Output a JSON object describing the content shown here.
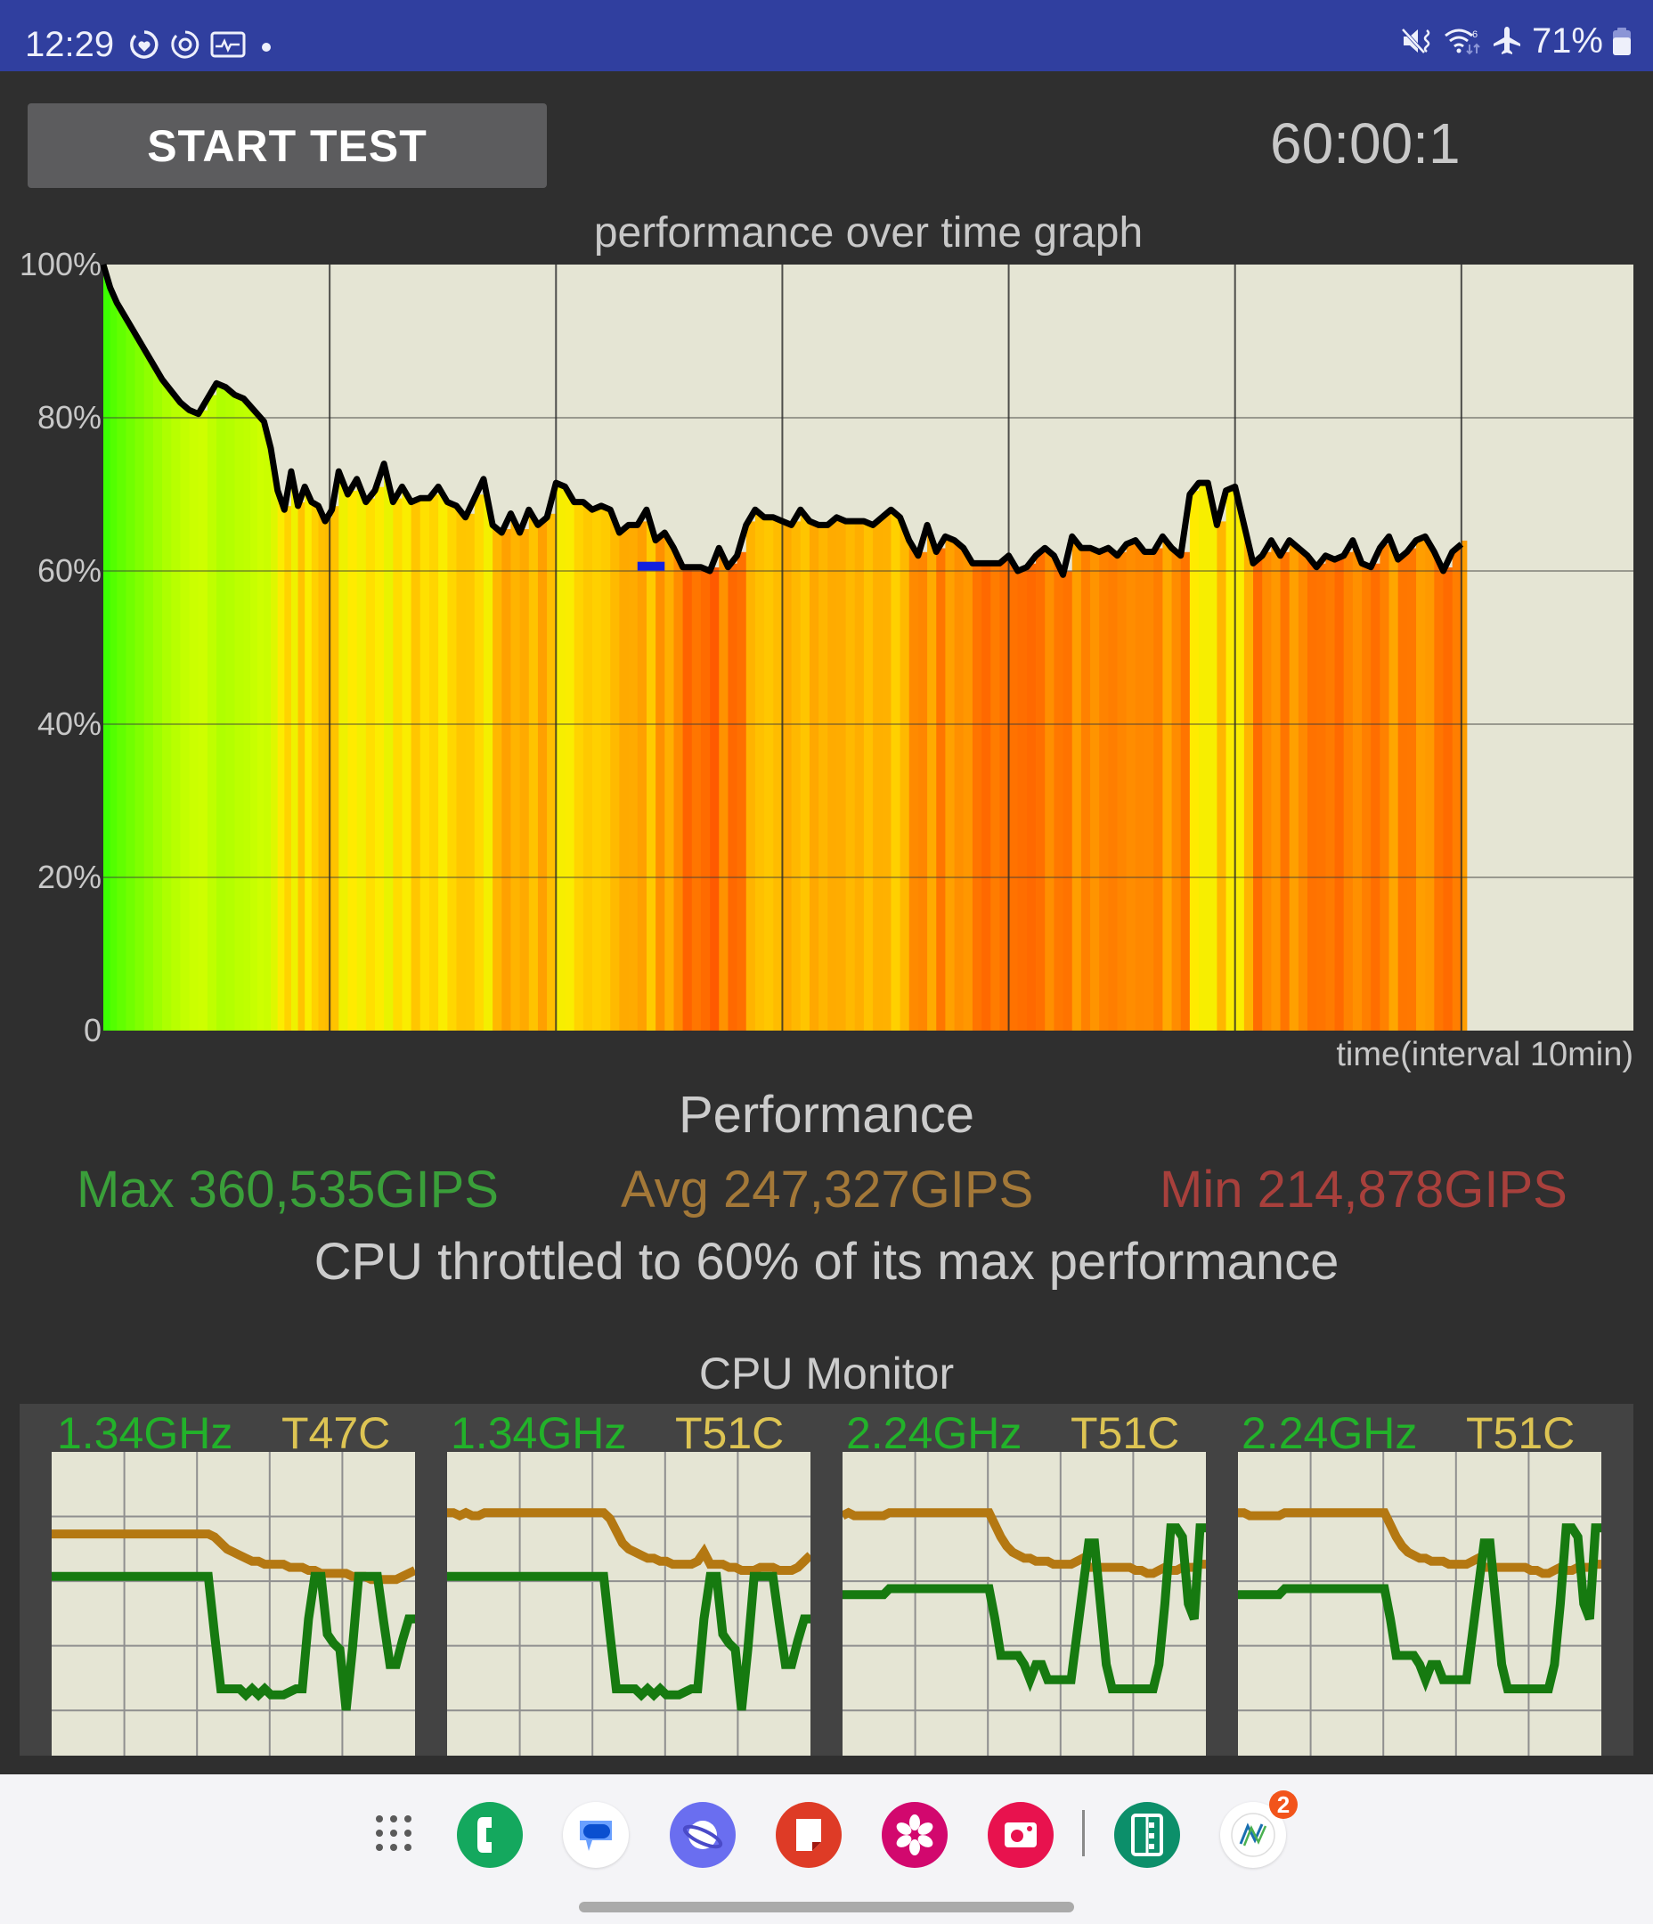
{
  "status_bar": {
    "time": "12:29",
    "left_icons": [
      "health-ring-icon",
      "sync-ring-icon",
      "activity-monitor-icon",
      "notification-dot"
    ],
    "right_icons": [
      "mute-vibrate-icon",
      "wifi-6-icon",
      "airplane-mode-icon"
    ],
    "battery_percent": "71%",
    "battery_level": 0.71
  },
  "header": {
    "start_button_label": "START TEST",
    "timer": "60:00:1"
  },
  "chart_data": {
    "type": "area",
    "title": "performance over time graph",
    "xlabel": "time(interval 10min)",
    "ylabel": "",
    "y_tick_labels": [
      "100%",
      "80%",
      "60%",
      "40%",
      "20%",
      "0"
    ],
    "y_ticks": [
      100,
      80,
      60,
      40,
      20,
      0
    ],
    "ylim": [
      0,
      100
    ],
    "xlim_minutes": [
      0,
      67.6
    ],
    "x_gridlines_minutes": [
      10,
      20,
      30,
      40,
      50,
      60
    ],
    "grid": true,
    "legend": "none",
    "series": [
      {
        "name": "performance",
        "x_minutes": [
          0,
          0.3,
          0.6,
          1.0,
          1.4,
          1.8,
          2.2,
          2.6,
          3.0,
          3.4,
          3.8,
          4.2,
          4.6,
          5.0,
          5.4,
          5.8,
          6.2,
          6.5,
          6.8,
          7.1,
          7.4,
          7.7,
          8.0,
          8.3,
          8.6,
          8.9,
          9.2,
          9.5,
          9.8,
          10.1,
          10.4,
          10.8,
          11.2,
          11.6,
          12.0,
          12.4,
          12.8,
          13.2,
          13.6,
          14.0,
          14.4,
          14.8,
          15.2,
          15.6,
          16.0,
          16.4,
          16.8,
          17.2,
          17.6,
          18.0,
          18.4,
          18.8,
          19.2,
          19.6,
          20.0,
          20.4,
          20.8,
          21.2,
          21.6,
          22.0,
          22.4,
          22.8,
          23.2,
          23.6,
          24.0,
          24.4,
          24.8,
          25.2,
          25.6,
          26.0,
          26.4,
          26.8,
          27.2,
          27.6,
          28.0,
          28.4,
          28.8,
          29.2,
          29.6,
          30.0,
          30.4,
          30.8,
          31.2,
          31.6,
          32.0,
          32.4,
          32.8,
          33.2,
          33.6,
          34.0,
          34.4,
          34.8,
          35.2,
          35.6,
          36.0,
          36.4,
          36.8,
          37.2,
          37.6,
          38.0,
          38.4,
          38.8,
          39.2,
          39.6,
          40.0,
          40.4,
          40.8,
          41.2,
          41.6,
          42.0,
          42.4,
          42.8,
          43.2,
          43.6,
          44.0,
          44.4,
          44.8,
          45.2,
          45.6,
          46.0,
          46.4,
          46.8,
          47.2,
          47.6,
          48.0,
          48.4,
          48.8,
          49.2,
          49.6,
          50.0,
          50.4,
          50.8,
          51.2,
          51.6,
          52.0,
          52.4,
          52.8,
          53.2,
          53.6,
          54.0,
          54.4,
          54.8,
          55.2,
          55.6,
          56.0,
          56.4,
          56.8,
          57.2,
          57.6,
          58.0,
          58.4,
          58.8,
          59.2,
          59.6,
          60.0
        ],
        "values": [
          100,
          97,
          95,
          93,
          91,
          89,
          87,
          85,
          83.5,
          82,
          81,
          80.5,
          82.5,
          84.5,
          84,
          83,
          82.5,
          81.5,
          80.5,
          79.5,
          76,
          70.5,
          68,
          73,
          68.5,
          71,
          69,
          68.5,
          66.5,
          68,
          73,
          70,
          72,
          69,
          70.5,
          74,
          69,
          71,
          69,
          69.5,
          69.5,
          71,
          69,
          68.5,
          67,
          69.5,
          72,
          66,
          65,
          67.5,
          65,
          68,
          66,
          67,
          71.5,
          71,
          69,
          69,
          68,
          68.5,
          68,
          65,
          66,
          66,
          68,
          64,
          65,
          63,
          60.5,
          60.5,
          60.5,
          60,
          63,
          60.5,
          62,
          66,
          68,
          67,
          67,
          66.5,
          66,
          68,
          66.5,
          66,
          66,
          67,
          66.5,
          66.5,
          66.5,
          66,
          67,
          68,
          67,
          64,
          62,
          66,
          62.5,
          64.5,
          64,
          63,
          61,
          61,
          61,
          61,
          62,
          60,
          60.5,
          62,
          63,
          62,
          59.5,
          64.5,
          63,
          63,
          62.5,
          63,
          62,
          63.5,
          64,
          62.5,
          62.5,
          64.5,
          63,
          62,
          70,
          71.5,
          71.5,
          66,
          70.5,
          71,
          66,
          61,
          62,
          64,
          62,
          64,
          63,
          62,
          60.5,
          62,
          61.5,
          62,
          64,
          61,
          60.5,
          63,
          64.5,
          61.5,
          62.5,
          64,
          64.5,
          62.5,
          60,
          62.5,
          63.5,
          62.5,
          62.5,
          64.5,
          59,
          60,
          63,
          62,
          62.5,
          61,
          63,
          64,
          66.5,
          64.5
        ]
      }
    ],
    "min_marker": {
      "x_minutes": [
        23.6,
        24.8
      ],
      "value": 60.5,
      "color": "#1020e0"
    },
    "fill_colorscale": "green (100%) → yellow-green → yellow → orange (~60%) per time slice"
  },
  "summary": {
    "title": "Performance",
    "max": "Max 360,535GIPS",
    "avg": "Avg 247,327GIPS",
    "min": "Min 214,878GIPS",
    "throttle_message": "CPU throttled to 60% of its max performance",
    "colors": {
      "max": "#3a9f3a",
      "avg": "#a37838",
      "min": "#a8403c"
    }
  },
  "cpu_monitor": {
    "title": "CPU Monitor",
    "cores": [
      {
        "freq": "1.34GHz",
        "temp": "T47C",
        "freq_trace": [
          0.59,
          0.59,
          0.59,
          0.59,
          0.59,
          0.59,
          0.59,
          0.59,
          0.59,
          0.59,
          0.59,
          0.59,
          0.59,
          0.59,
          0.59,
          0.59,
          0.59,
          0.59,
          0.59,
          0.59,
          0.59,
          0.59,
          0.59,
          0.59,
          0.59,
          0.59,
          0.4,
          0.22,
          0.22,
          0.22,
          0.22,
          0.2,
          0.22,
          0.2,
          0.22,
          0.2,
          0.2,
          0.2,
          0.21,
          0.22,
          0.22,
          0.45,
          0.59,
          0.59,
          0.4,
          0.37,
          0.35,
          0.15,
          0.35,
          0.59,
          0.59,
          0.59,
          0.59,
          0.44,
          0.3,
          0.3,
          0.38,
          0.45,
          0.45
        ],
        "temp_trace": [
          0.73,
          0.73,
          0.73,
          0.73,
          0.73,
          0.73,
          0.73,
          0.73,
          0.73,
          0.73,
          0.73,
          0.73,
          0.73,
          0.73,
          0.73,
          0.73,
          0.73,
          0.73,
          0.73,
          0.73,
          0.73,
          0.73,
          0.73,
          0.73,
          0.73,
          0.73,
          0.72,
          0.7,
          0.68,
          0.67,
          0.66,
          0.65,
          0.64,
          0.64,
          0.63,
          0.63,
          0.63,
          0.63,
          0.62,
          0.62,
          0.62,
          0.61,
          0.61,
          0.6,
          0.6,
          0.6,
          0.6,
          0.6,
          0.59,
          0.59,
          0.59,
          0.58,
          0.58,
          0.58,
          0.58,
          0.58,
          0.59,
          0.6,
          0.61
        ]
      },
      {
        "freq": "1.34GHz",
        "temp": "T51C",
        "freq_trace": [
          0.59,
          0.59,
          0.59,
          0.59,
          0.59,
          0.59,
          0.59,
          0.59,
          0.59,
          0.59,
          0.59,
          0.59,
          0.59,
          0.59,
          0.59,
          0.59,
          0.59,
          0.59,
          0.59,
          0.59,
          0.59,
          0.59,
          0.59,
          0.59,
          0.59,
          0.59,
          0.4,
          0.22,
          0.22,
          0.22,
          0.22,
          0.2,
          0.22,
          0.2,
          0.22,
          0.2,
          0.2,
          0.2,
          0.21,
          0.22,
          0.22,
          0.45,
          0.59,
          0.59,
          0.4,
          0.37,
          0.35,
          0.15,
          0.35,
          0.59,
          0.59,
          0.59,
          0.59,
          0.44,
          0.3,
          0.3,
          0.38,
          0.45,
          0.45
        ],
        "temp_trace": [
          0.8,
          0.8,
          0.79,
          0.8,
          0.79,
          0.79,
          0.8,
          0.8,
          0.8,
          0.8,
          0.8,
          0.8,
          0.8,
          0.8,
          0.8,
          0.8,
          0.8,
          0.8,
          0.8,
          0.8,
          0.8,
          0.8,
          0.8,
          0.8,
          0.8,
          0.8,
          0.78,
          0.74,
          0.7,
          0.68,
          0.67,
          0.66,
          0.65,
          0.65,
          0.64,
          0.64,
          0.63,
          0.63,
          0.63,
          0.63,
          0.64,
          0.67,
          0.63,
          0.63,
          0.63,
          0.62,
          0.62,
          0.61,
          0.61,
          0.61,
          0.62,
          0.62,
          0.62,
          0.61,
          0.61,
          0.61,
          0.62,
          0.64,
          0.66
        ]
      },
      {
        "freq": "2.24GHz",
        "temp": "T51C",
        "freq_trace": [
          0.53,
          0.53,
          0.53,
          0.53,
          0.53,
          0.53,
          0.53,
          0.53,
          0.55,
          0.55,
          0.55,
          0.55,
          0.55,
          0.55,
          0.55,
          0.55,
          0.55,
          0.55,
          0.55,
          0.55,
          0.55,
          0.55,
          0.55,
          0.55,
          0.55,
          0.55,
          0.45,
          0.33,
          0.33,
          0.33,
          0.33,
          0.3,
          0.25,
          0.3,
          0.3,
          0.25,
          0.25,
          0.25,
          0.25,
          0.25,
          0.4,
          0.55,
          0.7,
          0.7,
          0.5,
          0.3,
          0.22,
          0.22,
          0.22,
          0.22,
          0.22,
          0.22,
          0.22,
          0.22,
          0.3,
          0.5,
          0.75,
          0.75,
          0.72,
          0.5,
          0.45,
          0.75,
          0.75
        ],
        "temp_trace": [
          0.79,
          0.8,
          0.79,
          0.79,
          0.79,
          0.79,
          0.79,
          0.79,
          0.8,
          0.8,
          0.8,
          0.8,
          0.8,
          0.8,
          0.8,
          0.8,
          0.8,
          0.8,
          0.8,
          0.8,
          0.8,
          0.8,
          0.8,
          0.8,
          0.8,
          0.8,
          0.76,
          0.72,
          0.69,
          0.67,
          0.66,
          0.65,
          0.65,
          0.64,
          0.64,
          0.64,
          0.63,
          0.63,
          0.63,
          0.63,
          0.64,
          0.65,
          0.62,
          0.62,
          0.62,
          0.62,
          0.62,
          0.62,
          0.62,
          0.62,
          0.61,
          0.61,
          0.6,
          0.6,
          0.61,
          0.62,
          0.61,
          0.61,
          0.62,
          0.62,
          0.62,
          0.63,
          0.63
        ]
      },
      {
        "freq": "2.24GHz",
        "temp": "T51C",
        "freq_trace": [
          0.53,
          0.53,
          0.53,
          0.53,
          0.53,
          0.53,
          0.53,
          0.53,
          0.55,
          0.55,
          0.55,
          0.55,
          0.55,
          0.55,
          0.55,
          0.55,
          0.55,
          0.55,
          0.55,
          0.55,
          0.55,
          0.55,
          0.55,
          0.55,
          0.55,
          0.55,
          0.45,
          0.33,
          0.33,
          0.33,
          0.33,
          0.3,
          0.25,
          0.3,
          0.3,
          0.25,
          0.25,
          0.25,
          0.25,
          0.25,
          0.4,
          0.55,
          0.7,
          0.7,
          0.5,
          0.3,
          0.22,
          0.22,
          0.22,
          0.22,
          0.22,
          0.22,
          0.22,
          0.22,
          0.3,
          0.5,
          0.75,
          0.75,
          0.72,
          0.5,
          0.45,
          0.75,
          0.75
        ],
        "temp_trace": [
          0.8,
          0.8,
          0.79,
          0.79,
          0.79,
          0.79,
          0.79,
          0.79,
          0.8,
          0.8,
          0.8,
          0.8,
          0.8,
          0.8,
          0.8,
          0.8,
          0.8,
          0.8,
          0.8,
          0.8,
          0.8,
          0.8,
          0.8,
          0.8,
          0.8,
          0.8,
          0.76,
          0.72,
          0.69,
          0.67,
          0.66,
          0.65,
          0.65,
          0.64,
          0.64,
          0.64,
          0.63,
          0.63,
          0.63,
          0.63,
          0.64,
          0.65,
          0.62,
          0.62,
          0.62,
          0.62,
          0.62,
          0.62,
          0.62,
          0.62,
          0.61,
          0.61,
          0.6,
          0.6,
          0.61,
          0.62,
          0.61,
          0.61,
          0.62,
          0.62,
          0.62,
          0.63,
          0.63
        ]
      }
    ],
    "colors": {
      "freq_line": "#167a10",
      "temp_line": "#b47812",
      "freq_text": "#22b22a",
      "temp_text": "#ddc453"
    }
  },
  "dock": {
    "apps": [
      {
        "name": "phone",
        "color": "#14a85e"
      },
      {
        "name": "messages",
        "color": "#ffffff"
      },
      {
        "name": "internet",
        "color": "#6a6ef0"
      },
      {
        "name": "notes",
        "color": "#de3b26"
      },
      {
        "name": "gallery",
        "color": "#d2086e"
      },
      {
        "name": "camera",
        "color": "#e8124e"
      },
      {
        "name": "recent-app-1",
        "color": "#0c8f6a"
      },
      {
        "name": "recent-app-2",
        "color": "#ffffff"
      }
    ],
    "badge_count": "2"
  }
}
